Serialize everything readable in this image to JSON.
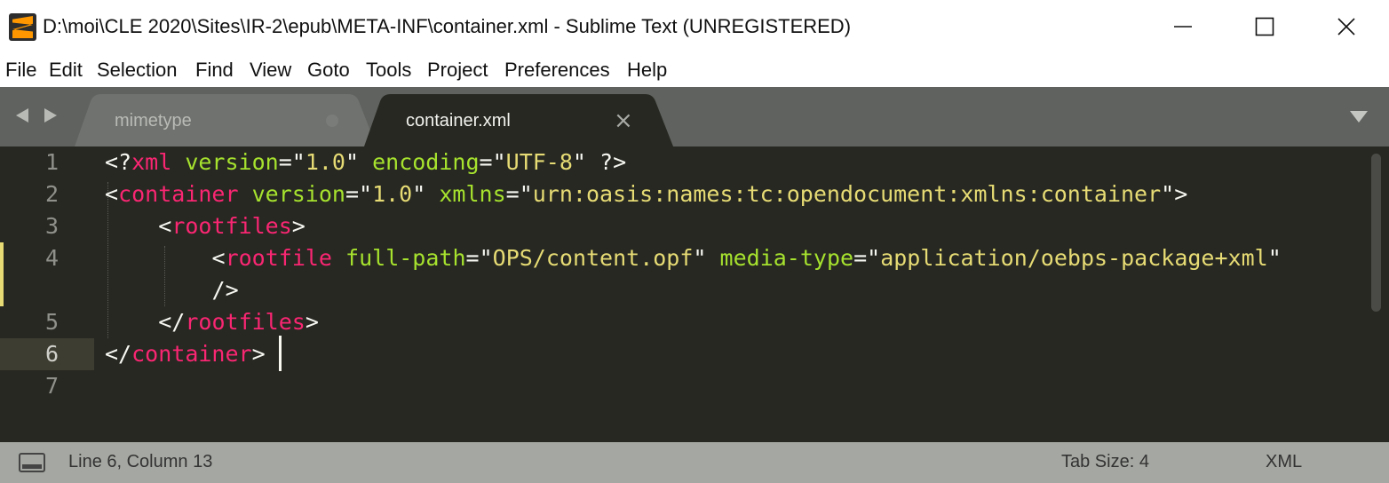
{
  "window": {
    "title": "D:\\moi\\CLE 2020\\Sites\\IR-2\\epub\\META-INF\\container.xml - Sublime Text (UNREGISTERED)",
    "icon": "sublime-text-logo-icon",
    "controls": [
      "minimize-icon",
      "maximize-icon",
      "close-icon"
    ]
  },
  "menu": {
    "items": [
      "File",
      "Edit",
      "Selection",
      "Find",
      "View",
      "Goto",
      "Tools",
      "Project",
      "Preferences",
      "Help"
    ]
  },
  "tabs": [
    {
      "label": "mimetype",
      "active": false,
      "indicator": "dirty-dot-icon"
    },
    {
      "label": "container.xml",
      "active": true,
      "close_glyph": "×"
    }
  ],
  "editor": {
    "gutter": [
      "1",
      "2",
      "3",
      "4",
      "",
      "5",
      "6",
      "7"
    ],
    "current_line": "6",
    "lines": [
      "<?xml version=\"1.0\" encoding=\"UTF-8\" ?>",
      "<container version=\"1.0\" xmlns=\"urn:oasis:names:tc:opendocument:xmlns:container\">",
      "    <rootfiles>",
      "        <rootfile full-path=\"OPS/content.opf\" media-type=\"application/oebps-package+xml\"",
      "        />",
      "    </rootfiles>",
      "</container>",
      ""
    ]
  },
  "status": {
    "position": "Line 6, Column 13",
    "tab_size": "Tab Size: 4",
    "syntax": "XML"
  },
  "colors": {
    "editor_bg": "#272822",
    "tag": "#f92672",
    "attribute": "#a6e22e",
    "string": "#e6db74",
    "text": "#f8f8f2",
    "line_number": "#8f908a",
    "tabbar_bg": "#5f625e",
    "statusbar_bg": "#a5a8a2"
  }
}
